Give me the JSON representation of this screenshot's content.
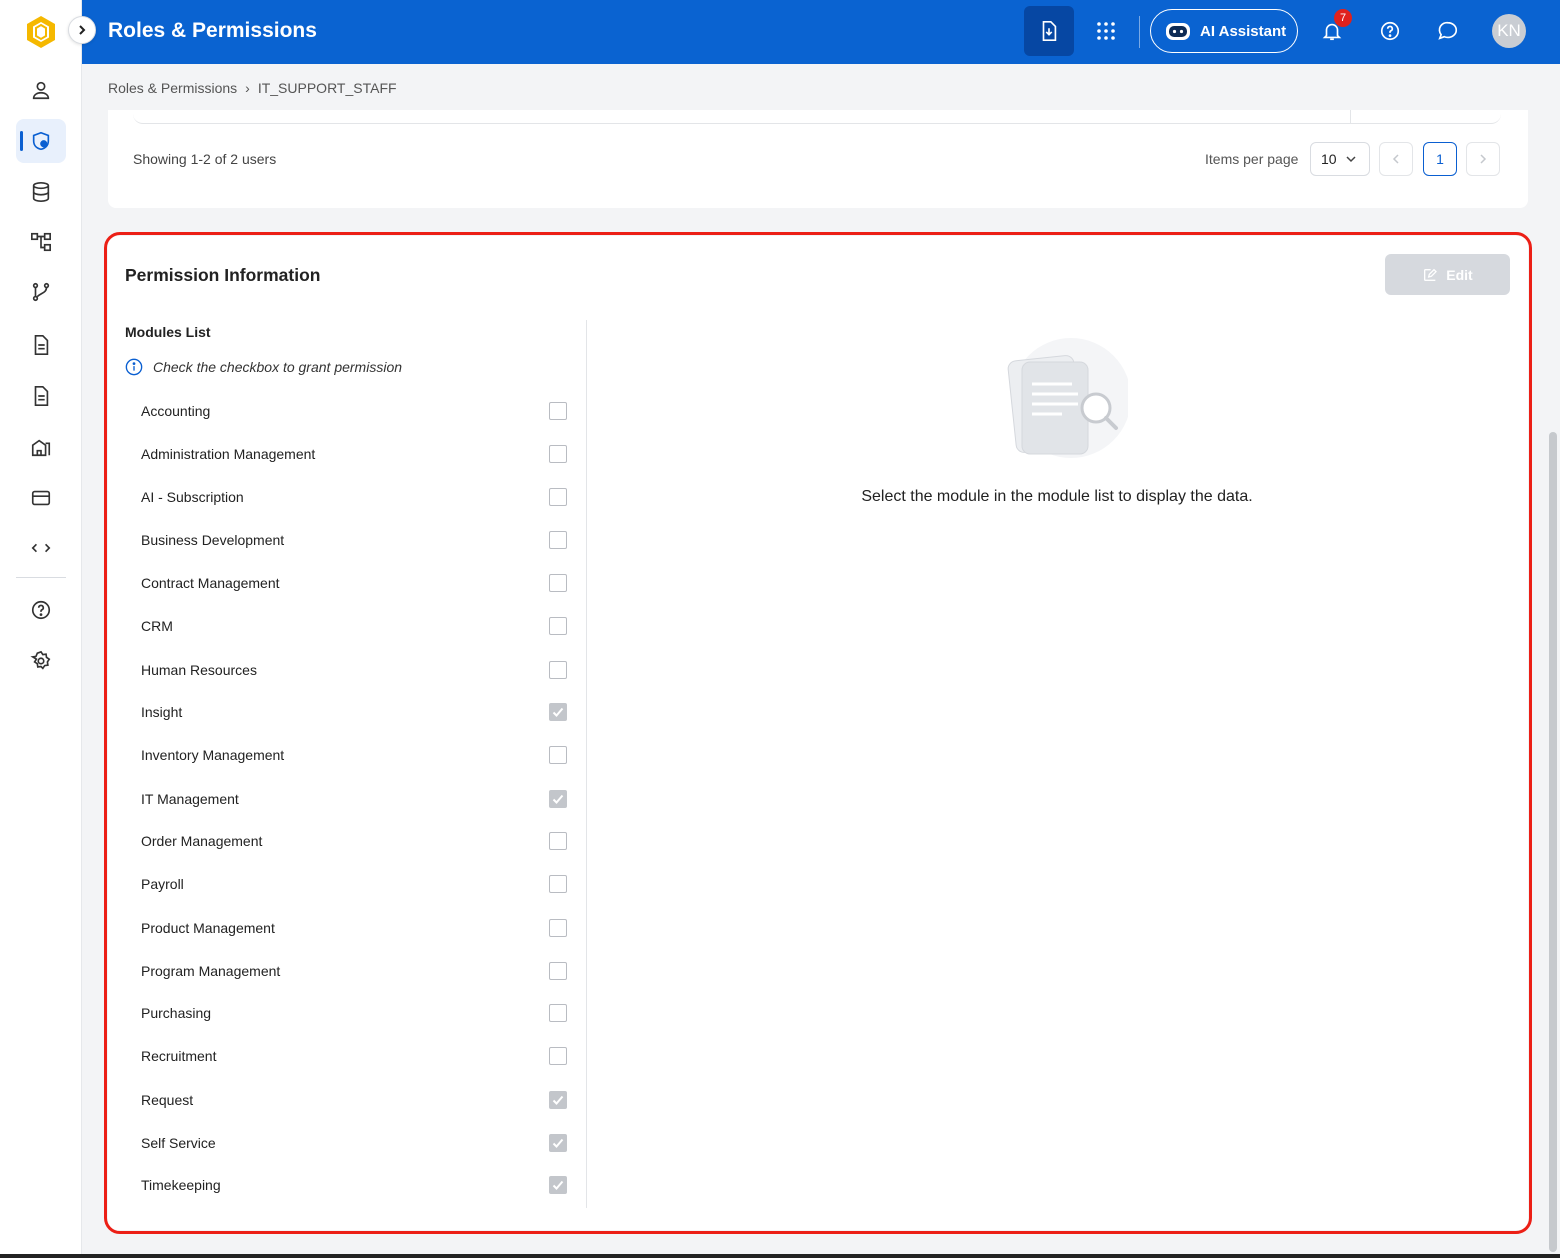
{
  "app": {
    "title": "Roles & Permissions",
    "ai_label": "AI Assistant",
    "notifications": "7",
    "avatar": "KN"
  },
  "breadcrumb": {
    "root": "Roles & Permissions",
    "separator": "›",
    "current": "IT_SUPPORT_STAFF"
  },
  "users_card": {
    "showing": "Showing 1-2 of 2 users",
    "items_per_page_label": "Items per page",
    "items_per_page_value": "10",
    "current_page": "1"
  },
  "permission": {
    "title": "Permission Information",
    "edit_label": "Edit",
    "modules_title": "Modules List",
    "hint": "Check the checkbox to grant permission",
    "empty_text": "Select the module in the module list to display the data.",
    "modules": [
      {
        "name": "Accounting",
        "checked": false
      },
      {
        "name": "Administration Management",
        "checked": false
      },
      {
        "name": "AI - Subscription",
        "checked": false
      },
      {
        "name": "Business Development",
        "checked": false
      },
      {
        "name": "Contract Management",
        "checked": false
      },
      {
        "name": "CRM",
        "checked": false
      },
      {
        "name": "Human Resources",
        "checked": false
      },
      {
        "name": "Insight",
        "checked": true
      },
      {
        "name": "Inventory Management",
        "checked": false
      },
      {
        "name": "IT Management",
        "checked": true
      },
      {
        "name": "Order Management",
        "checked": false
      },
      {
        "name": "Payroll",
        "checked": false
      },
      {
        "name": "Product Management",
        "checked": false
      },
      {
        "name": "Program Management",
        "checked": false
      },
      {
        "name": "Purchasing",
        "checked": false
      },
      {
        "name": "Recruitment",
        "checked": false
      },
      {
        "name": "Request",
        "checked": true
      },
      {
        "name": "Self Service",
        "checked": true
      },
      {
        "name": "Timekeeping",
        "checked": true
      }
    ]
  },
  "colors": {
    "brand": "#0a63d1",
    "highlight": "#ec1f16",
    "disabled": "#d6d9de"
  },
  "icons": {
    "sidebar": [
      "user-icon",
      "shield-user-icon",
      "database-icon",
      "hierarchy-icon",
      "workflow-icon",
      "document-icon",
      "document-icon",
      "building-icon",
      "card-icon",
      "code-icon",
      "help-icon",
      "settings-icon"
    ]
  }
}
